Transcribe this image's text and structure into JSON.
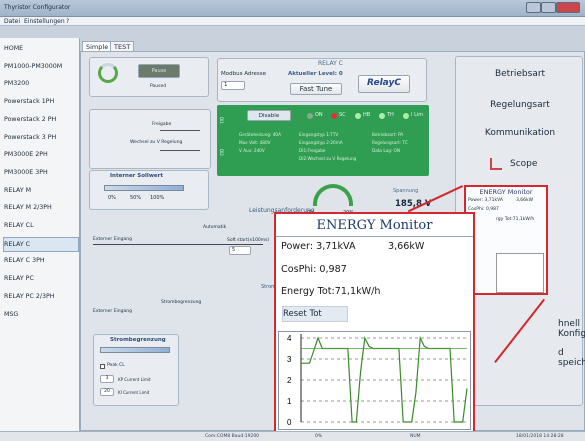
{
  "window": {
    "title": "Thyristor Configurator"
  },
  "menu": [
    "Datei",
    "Einstellungen",
    "?"
  ],
  "sidebar": [
    "HOME",
    "PM1000-PM3000M",
    "PM3200",
    "Powerstack 1PH",
    "Powerstack 2 PH",
    "Powerstack 3 PH",
    "PM3000E 2PH",
    "PM3000E 3PH",
    "RELAY M",
    "RELAY M 2/3PH",
    "RELAY CL",
    "RELAY C",
    "RELAY C 3PH",
    "RELAY PC",
    "RELAY PC 2/3PH",
    "MSG"
  ],
  "sidebar_selected": "RELAY C",
  "tabs": [
    "Simple",
    "TEST"
  ],
  "header": {
    "section": "RELAY C",
    "modbus_label": "Modbus Adresse",
    "modbus_value": "1",
    "level": "Aktueller Level: 0",
    "fast_tune": "Fast Tune",
    "brand": "RelayC"
  },
  "power": {
    "run_label": "Paused",
    "button": "Pause"
  },
  "switches": {
    "freigabe": "Freigabe",
    "wechsel": "Wechsel zu V Regelung"
  },
  "green": {
    "disable": "Disable",
    "leds": [
      "ON",
      "SC",
      "HB",
      "TH",
      "I Lim"
    ],
    "cols": [
      [
        "Geräteleistung: 40A",
        "Max Volt: 480V",
        "V Aux: 240V"
      ],
      [
        "Eingangstyp 1:TTV",
        "Eingangstyp 2:20mA",
        "DI1:Freigabe",
        "DI2:Wechsel zu V Regelung"
      ],
      [
        "Betriebsart: PA",
        "Regelungsart: TC",
        "Data Log: ON"
      ]
    ],
    "side": [
      "DI1",
      "DI2"
    ]
  },
  "sollwert": {
    "title": "Interner Sollwert",
    "ticks": [
      "0%",
      "50%",
      "100%"
    ],
    "label": "Externer Eingang",
    "auto": "Automatik"
  },
  "leistung": {
    "label": "Leistungsanforderung",
    "v": "0V",
    "percent": "20%"
  },
  "soft": {
    "label": "Soft start(x100ms)",
    "value": "5"
  },
  "gauge": {
    "title": "Spannung",
    "value": "185,8 V"
  },
  "strom_label": "Strom",
  "strombegr": {
    "title": "Strombegrenzung",
    "label": "Strombegrenzung",
    "ext": "Externer Eingang",
    "peak": "Peak CL",
    "kp_value": "3",
    "kp_label": "KP Current Limit",
    "ki_value": "20",
    "ki_label": "KI Current Limit"
  },
  "right": {
    "betriebsart": "Betriebsart",
    "regelungsart": "Regelungsart",
    "kommunikation": "Kommunikation",
    "scope": "Scope",
    "schnell": "hnell Konfig.",
    "speichern": "d speichern"
  },
  "small_energy": {
    "title": "ENERGY Monitor",
    "power_kva": "Power: 3,71kVA",
    "power_kw": "3,66kW",
    "cosphi": "CosPhi: 0,987",
    "etot": "rgy Tot:71,1kW/h"
  },
  "energy": {
    "title": "ENERGY Monitor",
    "power_label": "Power: 3,71kVA",
    "power_kw": "3,66kW",
    "cosphi": "CosPhi: 0,987",
    "etot": "Energy Tot:71,1kW/h",
    "reset": "Reset Tot"
  },
  "chart_data": {
    "type": "line",
    "ylim": [
      0,
      4
    ],
    "yticks": [
      "0",
      "1",
      "2",
      "3",
      "4"
    ],
    "series": [
      {
        "values": [
          2.8,
          2.8,
          2.8,
          3.4,
          4.0,
          3.5,
          3.5,
          3.5,
          3.5,
          3.5,
          3.5,
          3.5,
          0.0,
          0.0,
          2.4,
          4.0,
          3.6,
          3.5,
          3.5,
          3.5,
          3.5,
          3.5,
          3.5,
          3.5,
          0.0,
          0.0,
          0.0,
          1.4,
          4.0,
          3.6,
          3.5,
          3.5,
          3.5,
          3.5,
          3.5,
          3.5,
          0.0,
          0.0,
          0.0,
          1.6
        ]
      },
      {
        "values": [
          3.5,
          3.5,
          3.5,
          3.5,
          3.5,
          3.5,
          3.5,
          3.5,
          3.5,
          3.5,
          3.5,
          3.5,
          3.5,
          3.5,
          3.5,
          3.5,
          3.5,
          3.5,
          3.5,
          3.5,
          3.5,
          3.5,
          3.5,
          3.5,
          3.5,
          3.5,
          3.5,
          3.5,
          3.5,
          3.5,
          3.5,
          3.5,
          3.5,
          3.5,
          3.5,
          3.5,
          3.5,
          3.5,
          3.5,
          3.5
        ]
      }
    ],
    "colors": [
      "#3a8a2a",
      "#4e9e3a"
    ]
  },
  "status": {
    "port": "Com:COM8 Baud:19200",
    "progress": "0%",
    "num": "NUM",
    "datetime": "18/01/2018 14:28:28"
  }
}
